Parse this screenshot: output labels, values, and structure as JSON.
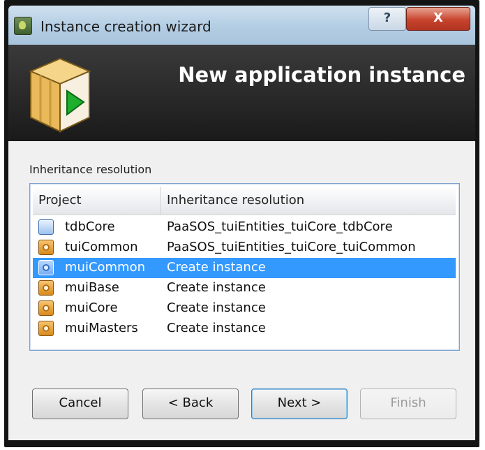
{
  "window": {
    "title": "Instance creation wizard",
    "help_label": "?",
    "close_label": "X"
  },
  "banner": {
    "title": "New application instance"
  },
  "section": {
    "label": "Inheritance resolution"
  },
  "table": {
    "columns": [
      "Project",
      "Inheritance resolution"
    ],
    "rows": [
      {
        "project": "tdbCore",
        "resolution": "PaaSOS_tuiEntities_tuiCore_tdbCore",
        "icon": "database-icon",
        "selected": false
      },
      {
        "project": "tuiCommon",
        "resolution": "PaaSOS_tuiEntities_tuiCore_tuiCommon",
        "icon": "gear-icon",
        "selected": false
      },
      {
        "project": "muiCommon",
        "resolution": "Create instance",
        "icon": "gear-icon",
        "selected": true
      },
      {
        "project": "muiBase",
        "resolution": "Create instance",
        "icon": "gear-icon",
        "selected": false
      },
      {
        "project": "muiCore",
        "resolution": "Create instance",
        "icon": "gear-icon",
        "selected": false
      },
      {
        "project": "muiMasters",
        "resolution": "Create instance",
        "icon": "gear-icon",
        "selected": false
      }
    ]
  },
  "buttons": {
    "cancel": "Cancel",
    "back": "< Back",
    "next": "Next >",
    "finish": "Finish",
    "finish_enabled": false
  },
  "colors": {
    "selection": "#3399ff",
    "banner": "#2a2a2a",
    "titlebar": "#b3cde3"
  }
}
